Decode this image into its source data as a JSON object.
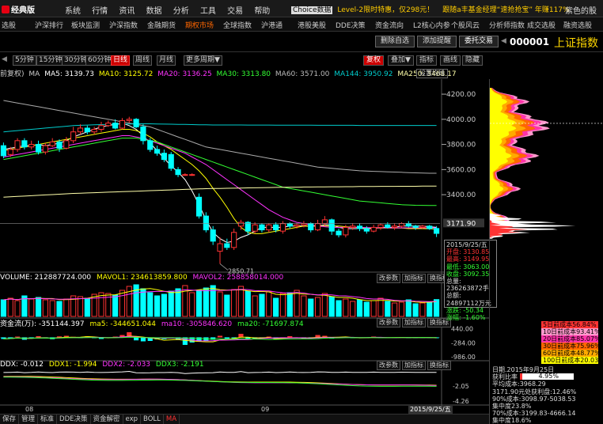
{
  "app": {
    "logo": "经典版",
    "menus": [
      "系统",
      "行情",
      "资讯",
      "数据",
      "分析",
      "工具",
      "交易",
      "帮助"
    ],
    "ticker_choice": "Choice数据",
    "ticker_1": "Level-2限时特惠，仅298元！",
    "ticker_2": "跟随a丰基金经理“速抢抢宝” 年赚117%",
    "top_right": "紫色的股"
  },
  "nav": {
    "items": [
      "选股",
      "沪深排行",
      "板块监测",
      "沪深指数",
      "金融期货",
      "期权市场",
      "全球指数",
      "沪港通",
      "港股美股",
      "DDE决策",
      "资金流向",
      "L2核心内参",
      "个股风云",
      "分析师指数",
      "成交选股",
      "融资选股"
    ],
    "active_index": 5
  },
  "actions": {
    "delete_label": "删除自选",
    "alert_label": "添加提醒",
    "trade_label": "委托交易",
    "hide_label": "隐藏",
    "stock_code": "000001",
    "stock_name": "上证指数"
  },
  "periods": {
    "items": [
      "5分钟",
      "15分钟",
      "30分钟",
      "60分钟",
      "日线",
      "周线",
      "月线",
      "更多周期▼"
    ],
    "active_index": 4
  },
  "tools": {
    "items": [
      "复权",
      "叠加▼",
      "指标",
      "画线",
      "隐藏"
    ],
    "highlight_index": 0,
    "arrows": "◀ ▶"
  },
  "ma_legend": {
    "prefix": "前复权)",
    "ma_label": "MA",
    "items": [
      {
        "label": "MA5: 3139.73",
        "color": "#ffffff"
      },
      {
        "label": "MA10: 3125.72",
        "color": "#ffff00"
      },
      {
        "label": "MA20: 3136.25",
        "color": "#ff33ff"
      },
      {
        "label": "MA30: 3313.80",
        "color": "#33ff33"
      },
      {
        "label": "MA60: 3571.00",
        "color": "#bbbbbb"
      },
      {
        "label": "MA144: 3950.92",
        "color": "#00cccc"
      },
      {
        "label": "MA250: 3468.17",
        "color": "#ffffaa"
      }
    ],
    "set_label": "设置均线"
  },
  "price_axis": {
    "ticks": [
      "4200.00",
      "4000.00",
      "3800.00",
      "3600.00",
      "3400.00",
      "3171.90"
    ],
    "low_label": "2850.71"
  },
  "volume": {
    "legend": [
      {
        "label": "VOLUME: 212887724.000",
        "color": "#ffffff"
      },
      {
        "label": "MAVOL1: 234613859.800",
        "color": "#ffff00"
      },
      {
        "label": "MAVOL2: 258858014.000",
        "color": "#ff33ff"
      }
    ],
    "buttons": [
      "改参数",
      "加指标",
      "换指标"
    ],
    "ticks": [
      "400000000"
    ]
  },
  "fund": {
    "legend": [
      {
        "label": "资金流(万): -351144.397",
        "color": "#ffffff"
      },
      {
        "label": "ma5: -344651.044",
        "color": "#ffff00"
      },
      {
        "label": "ma10: -305846.620",
        "color": "#ff33ff"
      },
      {
        "label": "ma20: -71697.874",
        "color": "#33ff33"
      }
    ],
    "buttons": [
      "改参数",
      "加指标",
      "换指标"
    ],
    "ticks": [
      "440.00",
      "-284.00",
      "-986.00"
    ]
  },
  "ddx": {
    "legend": [
      {
        "label": "DDX: -0.012",
        "color": "#ffffff"
      },
      {
        "label": "DDX1: -1.994",
        "color": "#ffff00"
      },
      {
        "label": "DDX2: -2.033",
        "color": "#ff33ff"
      },
      {
        "label": "DDX3: -2.191",
        "color": "#33ff33"
      }
    ],
    "buttons": [
      "改参数",
      "加指标",
      "换指标"
    ],
    "ticks": [
      "-2.05",
      "-4.26"
    ]
  },
  "x_axis": {
    "labels": [
      "08",
      "09"
    ],
    "current_date": "2015/9/25/五"
  },
  "infobox": {
    "rows": [
      {
        "text": "2015/9/25/五",
        "cls": ""
      },
      {
        "text": "开盘: 3130.85",
        "cls": "red"
      },
      {
        "text": "最高: 3149.95",
        "cls": "red"
      },
      {
        "text": "最低: 3063.00",
        "cls": "green"
      },
      {
        "text": "收盘: 3092.35",
        "cls": "green"
      },
      {
        "text": "总量: 236263872手",
        "cls": ""
      },
      {
        "text": "总额: 24897112万元",
        "cls": ""
      },
      {
        "text": "涨跌: -50.34",
        "cls": "green"
      },
      {
        "text": "涨幅: -1.60%",
        "cls": "green"
      }
    ]
  },
  "cost_legend": [
    {
      "label": "5日前成本56.84%",
      "color": "#ff3333"
    },
    {
      "label": "10日前成本93.41%",
      "color": "#ff99cc"
    },
    {
      "label": "20日前成本85.07%",
      "color": "#ff33aa"
    },
    {
      "label": "30日前成本75.96%",
      "color": "#ff6600"
    },
    {
      "label": "60日前成本48.77%",
      "color": "#ffaa00"
    },
    {
      "label": "100日前成本20.03%",
      "color": "#ffff00"
    }
  ],
  "cost_stats": {
    "date": "日期.2015年9月25日",
    "profit_label": "获利比率",
    "profit_value": "4.95%",
    "profit_ratio": 0.0495,
    "rows": [
      "平均成本:3968.29",
      "3171.90元处获利盘:12.46%",
      "90%成本:3098.97-5038.53",
      "集中度23.8%",
      "70%成本:3199.83-4666.14",
      "集中度18.6%"
    ]
  },
  "bottom_tabs": {
    "items": [
      "保存",
      "管理",
      "标准",
      "DDE决策",
      "资金解密",
      "exp",
      "BOLL",
      "MA"
    ],
    "active_index": 7
  },
  "chart_data": {
    "type": "candlestick",
    "title": "",
    "price_ylim": [
      2790,
      4320
    ],
    "candles": [
      [
        3790,
        3710,
        3815,
        3690
      ],
      [
        3720,
        3760,
        3780,
        3700
      ],
      [
        3760,
        3830,
        3850,
        3740
      ],
      [
        3830,
        3780,
        3850,
        3760
      ],
      [
        3780,
        3800,
        3830,
        3760
      ],
      [
        3800,
        3740,
        3830,
        3720
      ],
      [
        3740,
        3790,
        3810,
        3720
      ],
      [
        3790,
        3820,
        3850,
        3780
      ],
      [
        3820,
        3770,
        3840,
        3740
      ],
      [
        3770,
        3830,
        3860,
        3760
      ],
      [
        3830,
        3900,
        3940,
        3810
      ],
      [
        3900,
        3930,
        3960,
        3880
      ],
      [
        3930,
        3900,
        3950,
        3880
      ],
      [
        3900,
        3920,
        3940,
        3880
      ],
      [
        3920,
        3950,
        3980,
        3900
      ],
      [
        3950,
        3970,
        3990,
        3940
      ],
      [
        3970,
        3930,
        4000,
        3920
      ],
      [
        3930,
        3990,
        4010,
        3920
      ],
      [
        3990,
        4000,
        4020,
        3970
      ],
      [
        4000,
        3940,
        4010,
        3930
      ],
      [
        3940,
        3830,
        3960,
        3800
      ],
      [
        3830,
        3760,
        3850,
        3740
      ],
      [
        3760,
        3730,
        3790,
        3710
      ],
      [
        3730,
        3680,
        3760,
        3660
      ],
      [
        3720,
        3610,
        3740,
        3590
      ],
      [
        3600,
        3560,
        3620,
        3540
      ],
      [
        3560,
        3560,
        3570,
        3550
      ],
      [
        3560,
        3560,
        3570,
        3550
      ],
      [
        3380,
        3230,
        3410,
        3210
      ],
      [
        3230,
        3120,
        3260,
        3100
      ],
      [
        3120,
        3030,
        3150,
        3000
      ],
      [
        2950,
        3010,
        3060,
        2850
      ],
      [
        3010,
        2980,
        3050,
        2960
      ],
      [
        2980,
        3100,
        3130,
        2960
      ],
      [
        3150,
        3180,
        3200,
        3120
      ],
      [
        3180,
        3110,
        3190,
        3080
      ],
      [
        3110,
        3160,
        3180,
        3090
      ],
      [
        3160,
        3120,
        3170,
        3100
      ],
      [
        3120,
        3160,
        3170,
        3100
      ],
      [
        3160,
        3120,
        3180,
        3100
      ],
      [
        3110,
        3170,
        3190,
        3090
      ],
      [
        3170,
        3150,
        3180,
        3130
      ],
      [
        3150,
        3160,
        3170,
        3130
      ],
      [
        3160,
        3170,
        3190,
        3140
      ],
      [
        3170,
        3120,
        3180,
        3100
      ],
      [
        3120,
        3170,
        3200,
        3110
      ],
      [
        3170,
        3200,
        3230,
        3150
      ],
      [
        3200,
        3110,
        3210,
        3080
      ],
      [
        3110,
        3080,
        3130,
        3060
      ],
      [
        3080,
        3140,
        3160,
        3060
      ],
      [
        3140,
        3150,
        3170,
        3120
      ],
      [
        3150,
        3130,
        3170,
        3110
      ],
      [
        3130,
        3110,
        3150,
        3090
      ],
      [
        3110,
        3140,
        3160,
        3100
      ],
      [
        3140,
        3160,
        3170,
        3120
      ],
      [
        3160,
        3140,
        3180,
        3130
      ],
      [
        3140,
        3150,
        3170,
        3120
      ],
      [
        3150,
        3170,
        3180,
        3140
      ],
      [
        3170,
        3150,
        3190,
        3140
      ],
      [
        3150,
        3140,
        3160,
        3120
      ],
      [
        3140,
        3150,
        3160,
        3130
      ],
      [
        3150,
        3130,
        3160,
        3120
      ],
      [
        3131,
        3092,
        3150,
        3063
      ]
    ],
    "ma_lines": {
      "MA5": [
        3760,
        3770,
        3780,
        3790,
        3790,
        3800,
        3790,
        3800,
        3810,
        3830,
        3860,
        3880,
        3900,
        3920,
        3940,
        3950,
        3960,
        3970,
        3950,
        3920,
        3870,
        3810,
        3750,
        3690,
        3630,
        3580,
        3520,
        3430,
        3320,
        3200,
        3100,
        3050,
        3020,
        3030,
        3060,
        3080,
        3110,
        3140,
        3140,
        3140,
        3140,
        3150,
        3150,
        3150,
        3150,
        3150,
        3160,
        3160,
        3140,
        3130,
        3130,
        3130,
        3130,
        3130,
        3140,
        3140,
        3140,
        3150,
        3150,
        3150,
        3150,
        3145,
        3140
      ],
      "MA10": [
        3750,
        3760,
        3770,
        3780,
        3790,
        3800,
        3810,
        3820,
        3830,
        3840,
        3850,
        3860,
        3870,
        3880,
        3890,
        3900,
        3910,
        3920,
        3920,
        3910,
        3890,
        3860,
        3820,
        3790,
        3760,
        3720,
        3680,
        3640,
        3590,
        3530,
        3450,
        3380,
        3300,
        3210,
        3140,
        3100,
        3090,
        3090,
        3100,
        3110,
        3120,
        3130,
        3140,
        3150,
        3150,
        3150,
        3150,
        3150,
        3150,
        3145,
        3140,
        3140,
        3135,
        3135,
        3135,
        3135,
        3135,
        3135,
        3130,
        3130,
        3130,
        3128,
        3126
      ],
      "MA20": [
        3700,
        3710,
        3720,
        3730,
        3740,
        3750,
        3760,
        3770,
        3780,
        3790,
        3800,
        3810,
        3820,
        3830,
        3840,
        3850,
        3860,
        3870,
        3870,
        3860,
        3850,
        3830,
        3810,
        3790,
        3770,
        3750,
        3730,
        3700,
        3670,
        3640,
        3600,
        3560,
        3520,
        3480,
        3440,
        3400,
        3360,
        3320,
        3280,
        3250,
        3220,
        3200,
        3180,
        3170,
        3160,
        3150,
        3145,
        3140,
        3140,
        3140,
        3140,
        3140,
        3138,
        3137,
        3137,
        3136,
        3136,
        3136,
        3136,
        3136,
        3136,
        3136,
        3136
      ],
      "MA30": [
        3680,
        3690,
        3700,
        3710,
        3720,
        3730,
        3740,
        3750,
        3760,
        3770,
        3780,
        3790,
        3800,
        3810,
        3820,
        3830,
        3840,
        3850,
        3850,
        3850,
        3840,
        3830,
        3820,
        3800,
        3780,
        3760,
        3740,
        3720,
        3700,
        3680,
        3660,
        3640,
        3620,
        3600,
        3580,
        3560,
        3540,
        3520,
        3500,
        3480,
        3460,
        3450,
        3440,
        3430,
        3420,
        3410,
        3400,
        3390,
        3380,
        3370,
        3360,
        3350,
        3345,
        3340,
        3335,
        3330,
        3325,
        3320,
        3318,
        3316,
        3315,
        3314,
        3314
      ],
      "MA60": [
        4150,
        4140,
        4130,
        4120,
        4110,
        4100,
        4090,
        4080,
        4070,
        4060,
        4050,
        4040,
        4030,
        4020,
        4010,
        4000,
        3990,
        3980,
        3970,
        3960,
        3950,
        3940,
        3920,
        3900,
        3880,
        3860,
        3840,
        3820,
        3800,
        3780,
        3770,
        3760,
        3750,
        3740,
        3730,
        3720,
        3710,
        3700,
        3690,
        3680,
        3670,
        3660,
        3650,
        3640,
        3630,
        3620,
        3615,
        3610,
        3605,
        3600,
        3595,
        3590,
        3588,
        3586,
        3584,
        3582,
        3580,
        3578,
        3576,
        3574,
        3572,
        3571,
        3571
      ],
      "MA144": [
        3900,
        3905,
        3910,
        3915,
        3920,
        3925,
        3930,
        3935,
        3940,
        3945,
        3950,
        3952,
        3954,
        3956,
        3958,
        3960,
        3961,
        3962,
        3963,
        3964,
        3964,
        3964,
        3963,
        3962,
        3961,
        3960,
        3959,
        3958,
        3957,
        3956,
        3955,
        3955,
        3955,
        3955,
        3955,
        3954,
        3954,
        3954,
        3954,
        3953,
        3953,
        3953,
        3953,
        3953,
        3953,
        3952,
        3952,
        3952,
        3952,
        3952,
        3952,
        3951,
        3951,
        3951,
        3951,
        3951,
        3951,
        3951,
        3951,
        3951,
        3951,
        3951,
        3951
      ],
      "MA250": [
        3380,
        3383,
        3386,
        3389,
        3392,
        3395,
        3398,
        3401,
        3404,
        3407,
        3410,
        3412,
        3414,
        3416,
        3418,
        3420,
        3422,
        3424,
        3426,
        3428,
        3430,
        3432,
        3434,
        3436,
        3438,
        3440,
        3442,
        3444,
        3446,
        3448,
        3449,
        3450,
        3451,
        3452,
        3453,
        3454,
        3455,
        3456,
        3457,
        3458,
        3459,
        3460,
        3460,
        3461,
        3461,
        3462,
        3462,
        3463,
        3463,
        3464,
        3464,
        3465,
        3465,
        3465,
        3466,
        3466,
        3466,
        3467,
        3467,
        3467,
        3468,
        3468,
        3468
      ]
    },
    "volume": [
      2.1,
      2.3,
      2.0,
      2.6,
      2.2,
      2.4,
      2.1,
      2.0,
      1.9,
      2.2,
      2.6,
      2.5,
      2.3,
      2.8,
      3.0,
      2.9,
      2.7,
      3.3,
      3.8,
      4.0,
      3.5,
      3.0,
      2.6,
      2.8,
      3.2,
      3.5,
      3.9,
      3.0,
      3.3,
      3.6,
      3.9,
      3.1,
      2.7,
      3.4,
      3.8,
      3.2,
      2.6,
      2.8,
      3.1,
      2.3,
      2.9,
      3.0,
      3.3,
      2.6,
      2.2,
      2.4,
      2.9,
      2.5,
      2.0,
      2.2,
      1.9,
      2.1,
      1.8,
      2.0,
      2.3,
      1.9,
      1.7,
      1.8,
      2.1,
      1.6,
      1.7,
      1.8,
      2.13
    ],
    "fund_flow": [
      -80,
      -40,
      40,
      -120,
      -60,
      60,
      -40,
      -90,
      50,
      80,
      30,
      -20,
      60,
      -40,
      -80,
      -30,
      40,
      120,
      260,
      -150,
      -200,
      -180,
      -100,
      -90,
      -60,
      -120,
      -380,
      -260,
      -200,
      -160,
      -120,
      80,
      -60,
      -40,
      180,
      -120,
      -80,
      -60,
      40,
      -100,
      -40,
      60,
      -30,
      -80,
      -40,
      120,
      80,
      -60,
      -40,
      30,
      -20,
      -40,
      -30,
      40,
      -20,
      -30,
      -20,
      20,
      -10,
      -20,
      -30,
      -20,
      -35
    ],
    "fund_ylim": [
      -1100,
      500
    ],
    "ddx_ylim": [
      -4.6,
      0.3
    ]
  }
}
